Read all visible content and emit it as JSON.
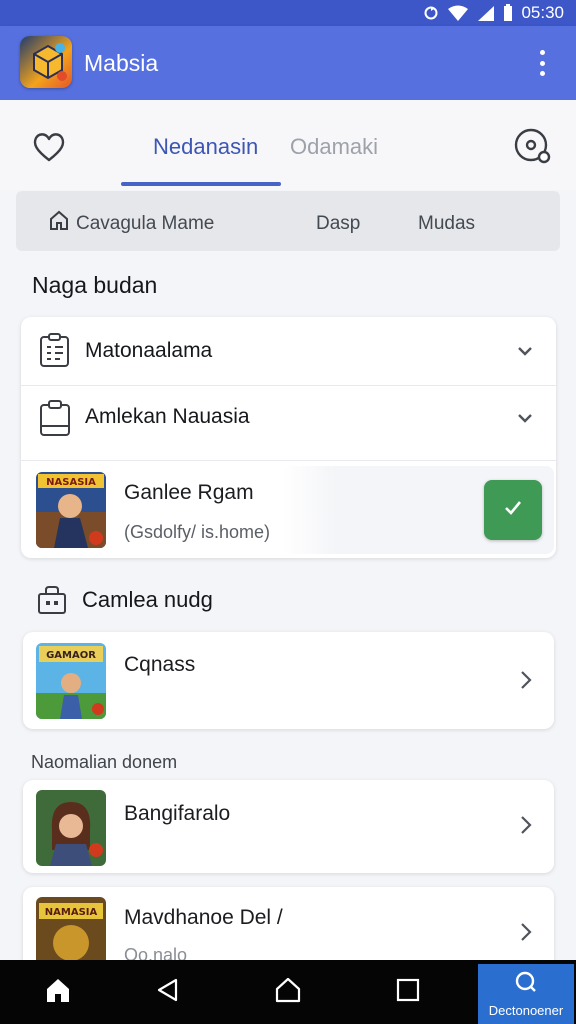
{
  "status_bar": {
    "time": "05:30"
  },
  "app_bar": {
    "title": "Mabsia",
    "icons": [
      "app-logo",
      "more-vert-icon"
    ]
  },
  "tabs": [
    {
      "label": "Nedanasin",
      "active": true
    },
    {
      "label": "Odamaki",
      "active": false
    }
  ],
  "sub_nav": {
    "items": [
      {
        "label": "Cavagula Mame",
        "icon": "home-icon"
      },
      {
        "label": "Dasp"
      },
      {
        "label": "Mudas"
      }
    ]
  },
  "section1": {
    "title": "Naga budan",
    "rows": [
      {
        "label": "Matonaalama",
        "icon": "list-doc-icon"
      },
      {
        "label": "Amlekan Nauasia",
        "icon": "clipboard-icon"
      }
    ],
    "game": {
      "name": "Ganlee Rgam",
      "subtitle": "(Gsdolfy/ is.home)",
      "thumb_text": "NASASIA"
    }
  },
  "section2": {
    "title": "Camlea nudg",
    "game": {
      "name": "Cqnass",
      "thumb_text": "GAMAOR"
    }
  },
  "section3": {
    "title": "Naomalian donem",
    "games": [
      {
        "name": "Bangifaralo"
      },
      {
        "name": "Mavdhanoe Del /",
        "subtitle": "Oo.nalo",
        "thumb_text": "NAMASIA"
      }
    ]
  },
  "bottom_nav": {
    "discover_label": "Dectonoener"
  },
  "colors": {
    "primary": "#5670e0",
    "status_bar": "#3d56c8",
    "accent": "#3c56b3",
    "action_green": "#3f9a55",
    "discover_blue": "#2a6fd0"
  }
}
